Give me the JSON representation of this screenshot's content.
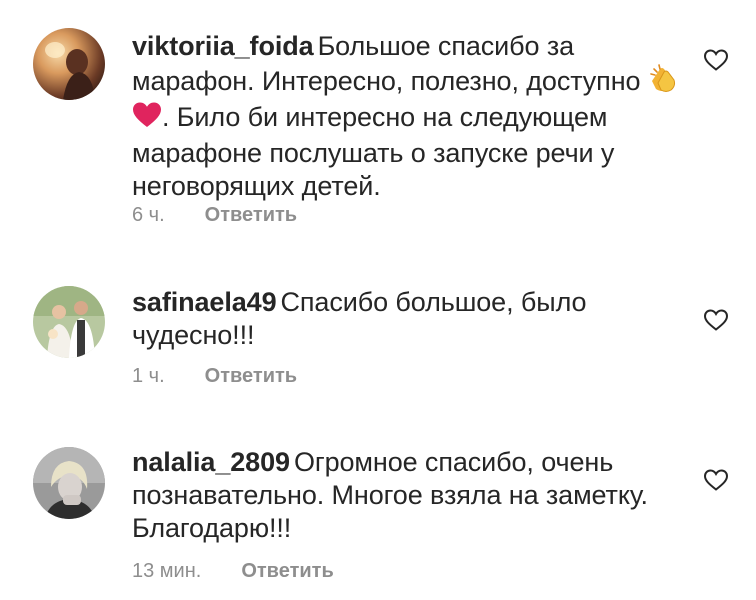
{
  "comments": [
    {
      "username": "viktoriia_foida",
      "text_part1": "Большое спасибо за марафон. Интересно, полезно, доступно",
      "emojis": [
        "clapping-hands",
        "red-heart"
      ],
      "text_part2": ". Било би интересно на следующем марафоне послушать о запуске речи у неговорящих детей.",
      "time": "6 ч.",
      "reply_label": "Ответить"
    },
    {
      "username": "safinaela49",
      "text_part1": "Спасибо большое, было чудесно!!!",
      "time": "1 ч.",
      "reply_label": "Ответить"
    },
    {
      "username": "nalalia_2809",
      "text_part1": "Огромное спасибо, очень познавательно. Многое взяла на заметку. Благодарю!!!",
      "time": "13 мин.",
      "reply_label": "Ответить"
    }
  ],
  "colors": {
    "text": "#262626",
    "secondary": "#8e8e8e",
    "heart_emoji": "#e0245e"
  },
  "icons": {
    "like": "heart-outline-icon"
  }
}
